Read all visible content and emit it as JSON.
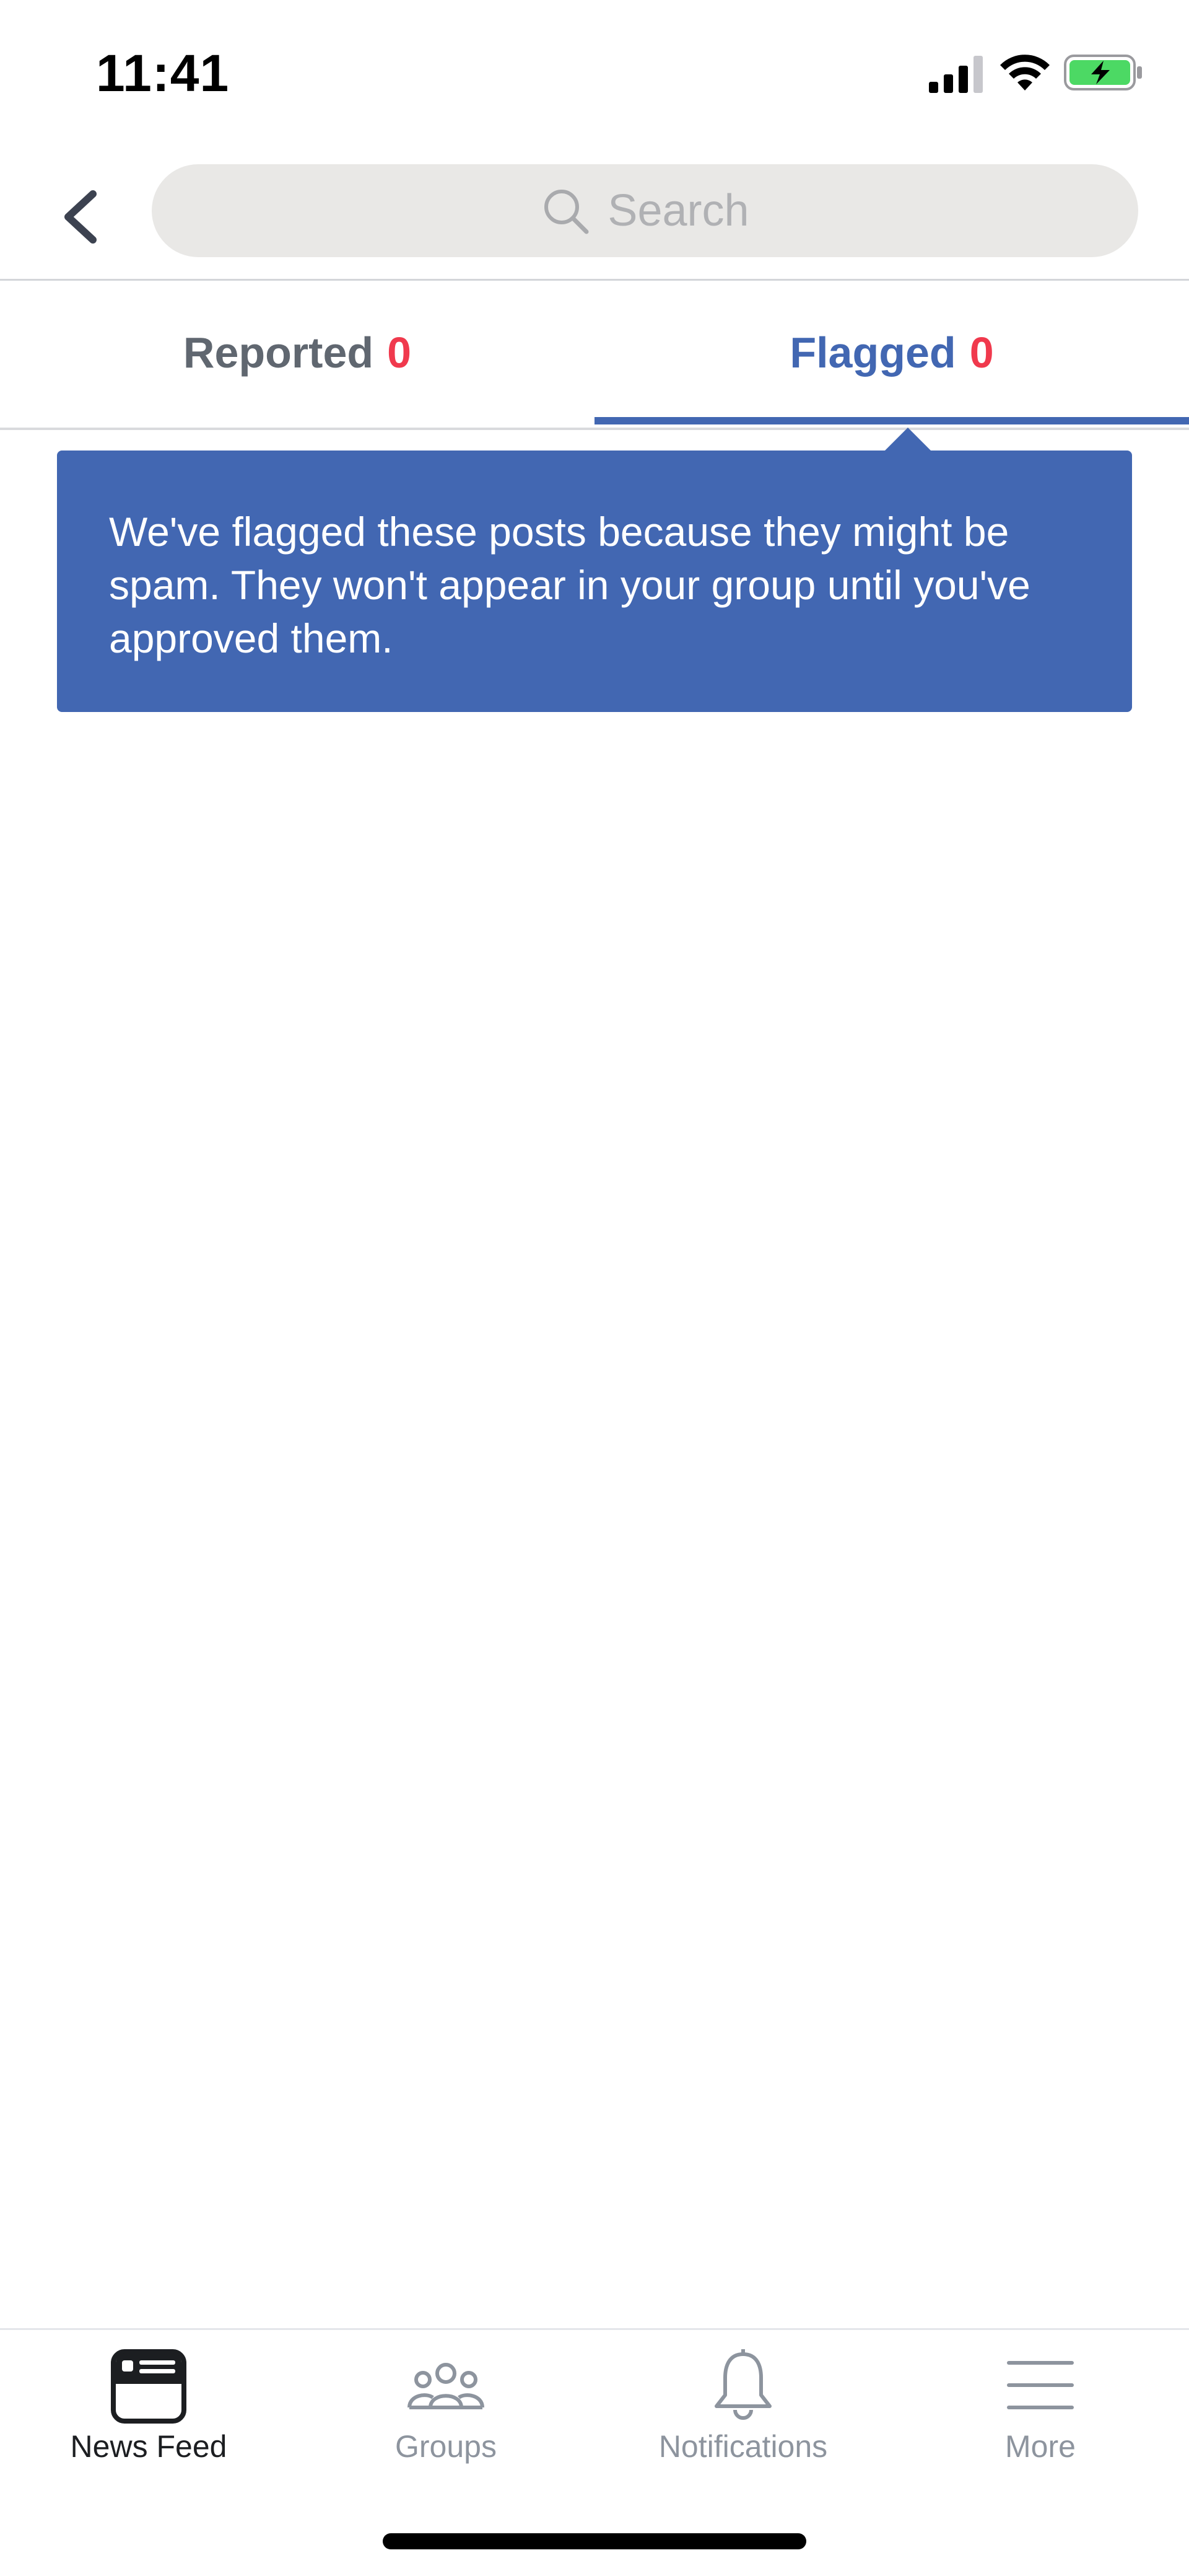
{
  "status_bar": {
    "time": "11:41"
  },
  "search": {
    "placeholder": "Search"
  },
  "tabs": [
    {
      "label": "Reported",
      "count": "0",
      "active": false
    },
    {
      "label": "Flagged",
      "count": "0",
      "active": true
    }
  ],
  "tooltip": {
    "text": "We've flagged these posts because they might be spam. They won't appear in your group until you've approved them."
  },
  "bottom_nav": [
    {
      "label": "News Feed",
      "icon": "news-feed-icon",
      "active": true
    },
    {
      "label": "Groups",
      "icon": "groups-icon",
      "active": false
    },
    {
      "label": "Notifications",
      "icon": "bell-icon",
      "active": false
    },
    {
      "label": "More",
      "icon": "menu-icon",
      "active": false
    }
  ],
  "colors": {
    "accent": "#4267b2",
    "count_red": "#f0394d",
    "search_bg": "#e9e8e6"
  }
}
